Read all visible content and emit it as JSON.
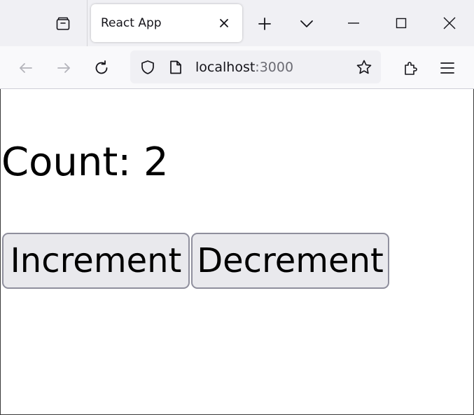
{
  "browser": {
    "tab": {
      "title": "React App"
    },
    "urlbar": {
      "host": "localhost",
      "port": ":3000"
    }
  },
  "icons": {
    "tab_list": "firefox-view-icon",
    "tab_close": "close-icon",
    "new_tab": "plus-icon",
    "all_tabs": "chevron-down-icon",
    "minimize": "minimize-icon",
    "maximize": "maximize-icon",
    "window_close": "close-icon",
    "back": "arrow-left-icon",
    "forward": "arrow-right-icon",
    "reload": "reload-icon",
    "tracking_protection": "shield-icon",
    "page_info": "page-icon",
    "bookmark": "star-icon",
    "extensions": "puzzle-icon",
    "menu": "hamburger-icon"
  },
  "colors": {
    "tabbar_bg": "#f0f0f4",
    "navbar_bg": "#f9f9fb",
    "button_bg": "#e9e9ed",
    "button_border": "#8f8f9d",
    "disabled_icon": "#b4b4bb"
  },
  "app": {
    "count_label": "Count: 2",
    "increment_label": "Increment",
    "decrement_label": "Decrement"
  }
}
